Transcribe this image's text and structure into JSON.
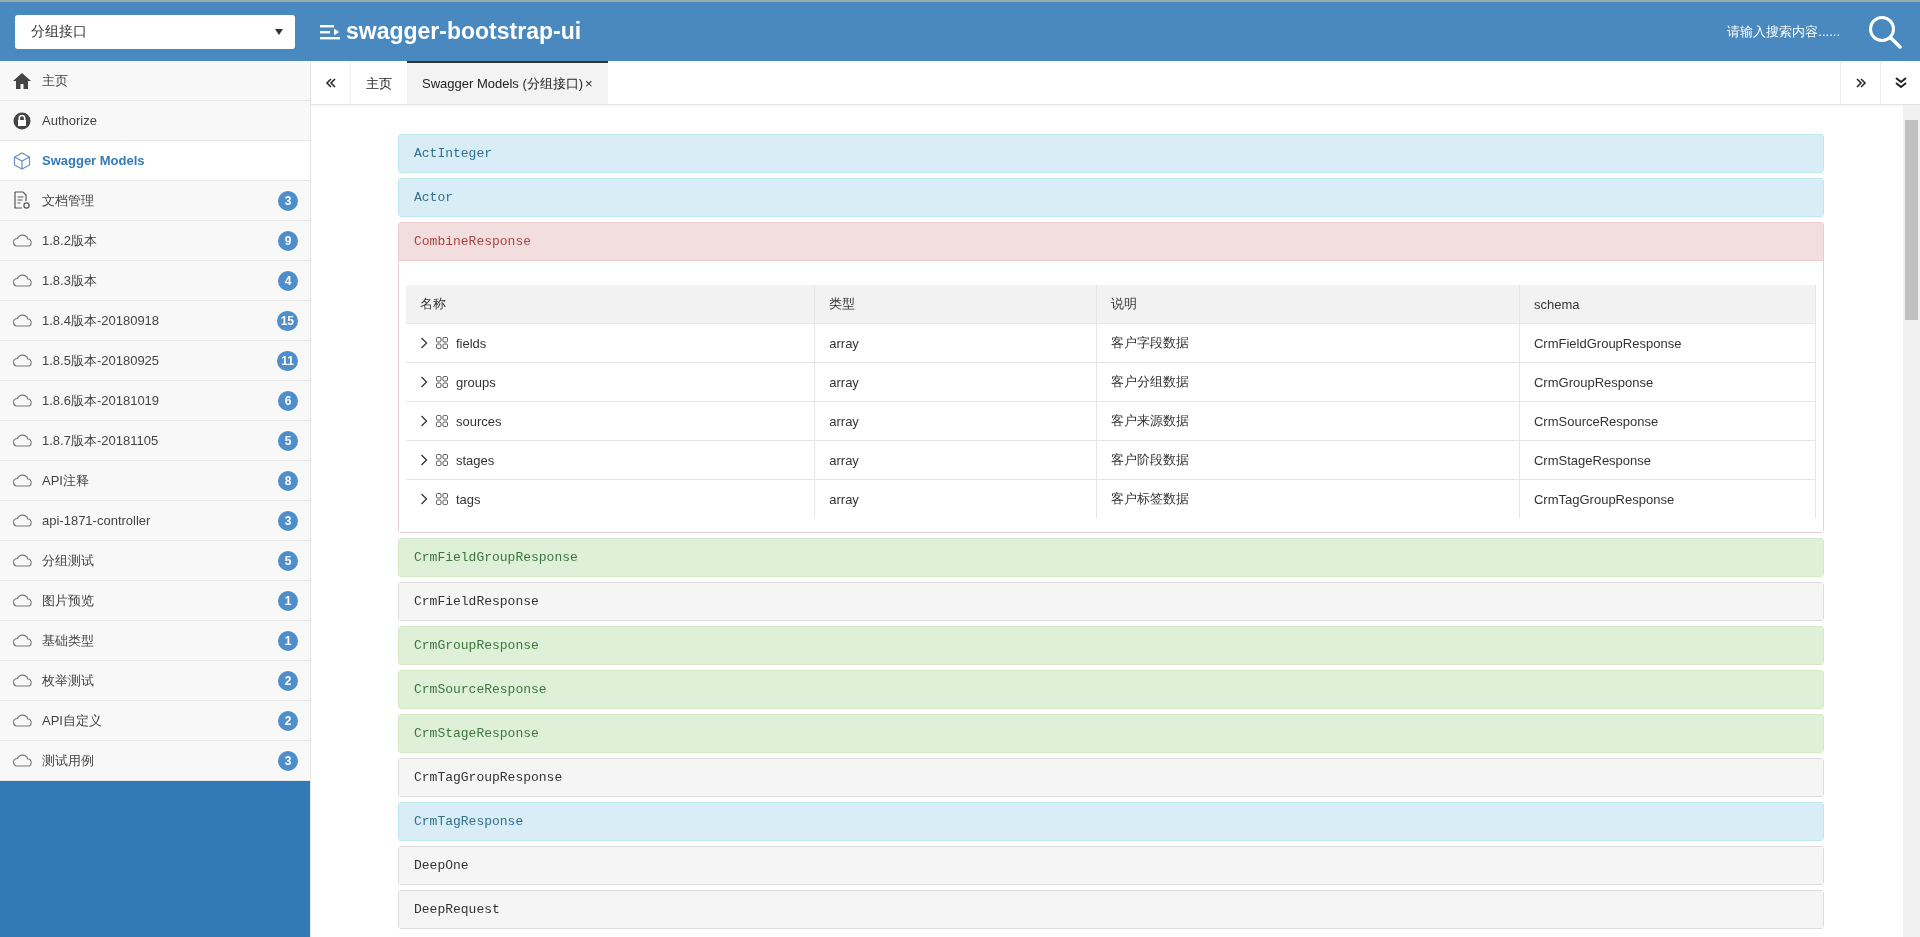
{
  "header": {
    "group_select": {
      "value": "分组接口"
    },
    "title": "swagger-bootstrap-ui",
    "search": {
      "placeholder": "请输入搜索内容......"
    }
  },
  "sidebar": {
    "items": [
      {
        "label": "主页",
        "kind": "home",
        "selected": false
      },
      {
        "label": "Authorize",
        "kind": "lock",
        "selected": false
      },
      {
        "label": "Swagger Models",
        "kind": "models",
        "selected": true
      },
      {
        "label": "文档管理",
        "kind": "doc",
        "badge": "3",
        "selected": false
      },
      {
        "label": "1.8.2版本",
        "kind": "cloud",
        "badge": "9",
        "selected": false
      },
      {
        "label": "1.8.3版本",
        "kind": "cloud",
        "badge": "4",
        "selected": false
      },
      {
        "label": "1.8.4版本-20180918",
        "kind": "cloud",
        "badge": "15",
        "selected": false
      },
      {
        "label": "1.8.5版本-20180925",
        "kind": "cloud",
        "badge": "11",
        "selected": false
      },
      {
        "label": "1.8.6版本-20181019",
        "kind": "cloud",
        "badge": "6",
        "selected": false
      },
      {
        "label": "1.8.7版本-20181105",
        "kind": "cloud",
        "badge": "5",
        "selected": false
      },
      {
        "label": "API注释",
        "kind": "cloud",
        "badge": "8",
        "selected": false
      },
      {
        "label": "api-1871-controller",
        "kind": "cloud",
        "badge": "3",
        "selected": false
      },
      {
        "label": "分组测试",
        "kind": "cloud",
        "badge": "5",
        "selected": false
      },
      {
        "label": "图片预览",
        "kind": "cloud",
        "badge": "1",
        "selected": false
      },
      {
        "label": "基础类型",
        "kind": "cloud",
        "badge": "1",
        "selected": false
      },
      {
        "label": "枚举测试",
        "kind": "cloud",
        "badge": "2",
        "selected": false
      },
      {
        "label": "API自定义",
        "kind": "cloud",
        "badge": "2",
        "selected": false
      },
      {
        "label": "测试用例",
        "kind": "cloud",
        "badge": "3",
        "selected": false
      }
    ]
  },
  "tabs": [
    {
      "label": "主页",
      "selected": false,
      "closable": false
    },
    {
      "label": "Swagger Models (分组接口)",
      "selected": true,
      "closable": true
    }
  ],
  "close_glyph": "×",
  "models": [
    {
      "name": "ActInteger",
      "kind": "info",
      "expanded": false
    },
    {
      "name": "Actor",
      "kind": "info",
      "expanded": false
    },
    {
      "name": "CombineResponse",
      "kind": "danger",
      "expanded": true,
      "columns": [
        "名称",
        "类型",
        "说明",
        "schema"
      ],
      "rows": [
        [
          "fields",
          "array",
          "客户字段数据",
          "CrmFieldGroupResponse"
        ],
        [
          "groups",
          "array",
          "客户分组数据",
          "CrmGroupResponse"
        ],
        [
          "sources",
          "array",
          "客户来源数据",
          "CrmSourceResponse"
        ],
        [
          "stages",
          "array",
          "客户阶段数据",
          "CrmStageResponse"
        ],
        [
          "tags",
          "array",
          "客户标签数据",
          "CrmTagGroupResponse"
        ]
      ]
    },
    {
      "name": "CrmFieldGroupResponse",
      "kind": "success",
      "expanded": false
    },
    {
      "name": "CrmFieldResponse",
      "kind": "default",
      "expanded": false
    },
    {
      "name": "CrmGroupResponse",
      "kind": "success",
      "expanded": false
    },
    {
      "name": "CrmSourceResponse",
      "kind": "success",
      "expanded": false
    },
    {
      "name": "CrmStageResponse",
      "kind": "success",
      "expanded": false
    },
    {
      "name": "CrmTagGroupResponse",
      "kind": "default",
      "expanded": false
    },
    {
      "name": "CrmTagResponse",
      "kind": "info",
      "expanded": false
    },
    {
      "name": "DeepOne",
      "kind": "default",
      "expanded": false
    },
    {
      "name": "DeepRequest",
      "kind": "default",
      "expanded": false
    }
  ]
}
